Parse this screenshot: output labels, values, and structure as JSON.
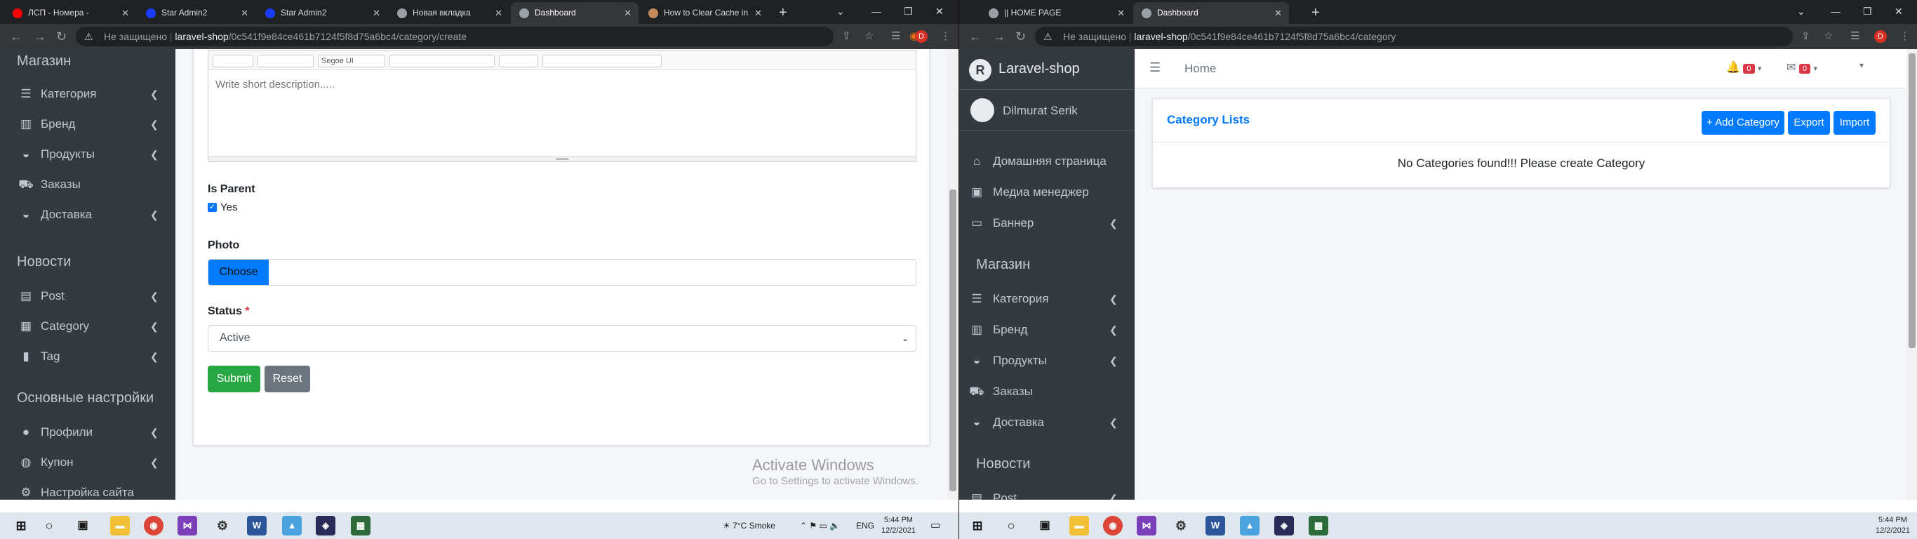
{
  "left": {
    "tabs": [
      {
        "title": "ЛСП - Номера -",
        "active": false,
        "fav": "#ff0000"
      },
      {
        "title": "Star Admin2",
        "active": false,
        "fav": "#1a3cff"
      },
      {
        "title": "Star Admin2",
        "active": false,
        "fav": "#1a3cff"
      },
      {
        "title": "Новая вкладка",
        "active": false,
        "fav": "#9aa0a6"
      },
      {
        "title": "Dashboard",
        "active": true,
        "fav": "#9aa0a6"
      },
      {
        "title": "How to Clear Cache in",
        "active": false,
        "fav": "#c58b5b"
      }
    ],
    "url": {
      "secure_label": "Не защищено",
      "host": "laravel-shop",
      "path": "/0c541f9e84ce461b7124f5f8d75a6bc4/category/create"
    },
    "profile_initial": "D",
    "sidebar": {
      "sections": [
        {
          "title": "Магазин",
          "items": [
            {
              "label": "Категория",
              "icon": "list-icon",
              "glyph": "☰",
              "chev": true
            },
            {
              "label": "Бренд",
              "icon": "building-icon",
              "glyph": "▥",
              "chev": true
            },
            {
              "label": "Продукты",
              "icon": "box-icon",
              "glyph": "◒",
              "chev": true
            },
            {
              "label": "Заказы",
              "icon": "cart-icon",
              "glyph": "⛟",
              "chev": false
            },
            {
              "label": "Доставка",
              "icon": "delivery-icon",
              "glyph": "◒",
              "chev": true
            }
          ]
        },
        {
          "title": "Новости",
          "items": [
            {
              "label": "Post",
              "icon": "post-icon",
              "glyph": "▤",
              "chev": true
            },
            {
              "label": "Category",
              "icon": "category-icon",
              "glyph": "▦",
              "chev": true
            },
            {
              "label": "Tag",
              "icon": "tag-icon",
              "glyph": "▮",
              "chev": true
            }
          ]
        },
        {
          "title": "Основные настройки",
          "items": [
            {
              "label": "Профили",
              "icon": "user-icon",
              "glyph": "●",
              "chev": true
            },
            {
              "label": "Купон",
              "icon": "coupon-icon",
              "glyph": "◍",
              "chev": true
            },
            {
              "label": "Настройка сайта",
              "icon": "gears-icon",
              "glyph": "⚙",
              "chev": false
            }
          ]
        }
      ]
    },
    "form": {
      "editor_placeholder": "Write short description.....",
      "editor_toolbar_font": "Segoe UI",
      "is_parent_label": "Is Parent",
      "is_parent_option": "Yes",
      "photo_label": "Photo",
      "choose_label": "Choose",
      "status_label": "Status",
      "status_required": "*",
      "status_value": "Active",
      "submit_label": "Submit",
      "reset_label": "Reset"
    },
    "watermark": {
      "title": "Activate Windows",
      "sub": "Go to Settings to activate Windows."
    },
    "taskbar": {
      "weather": "7°C  Smoke",
      "lang": "ENG",
      "time": "5:44 PM",
      "date": "12/2/2021"
    }
  },
  "right": {
    "tabs": [
      {
        "title": "|| HOME PAGE",
        "active": false,
        "fav": "#9aa0a6"
      },
      {
        "title": "Dashboard",
        "active": true,
        "fav": "#9aa0a6"
      }
    ],
    "url": {
      "secure_label": "Не защищено",
      "host": "laravel-shop",
      "path": "/0c541f9e84ce461b7124f5f8d75a6bc4/category"
    },
    "profile_initial": "D",
    "brand": "Laravel-shop",
    "user_name": "Dilmurat Serik",
    "sidebar": {
      "top_items": [
        {
          "label": "Домашняя страница",
          "icon": "home-icon",
          "glyph": "⌂",
          "chev": false
        },
        {
          "label": "Медиа менеджер",
          "icon": "media-icon",
          "glyph": "▣",
          "chev": false
        },
        {
          "label": "Баннер",
          "icon": "monitor-icon",
          "glyph": "▭",
          "chev": true
        }
      ],
      "sections": [
        {
          "title": "Магазин",
          "items": [
            {
              "label": "Категория",
              "icon": "list-icon",
              "glyph": "☰",
              "chev": true
            },
            {
              "label": "Бренд",
              "icon": "building-icon",
              "glyph": "▥",
              "chev": true
            },
            {
              "label": "Продукты",
              "icon": "box-icon",
              "glyph": "◒",
              "chev": true
            },
            {
              "label": "Заказы",
              "icon": "cart-icon",
              "glyph": "⛟",
              "chev": false
            },
            {
              "label": "Доставка",
              "icon": "delivery-icon",
              "glyph": "◒",
              "chev": true
            }
          ]
        },
        {
          "title": "Новости",
          "items": [
            {
              "label": "Post",
              "icon": "post-icon",
              "glyph": "▤",
              "chev": true
            }
          ]
        }
      ]
    },
    "navbar": {
      "home": "Home",
      "notif_count": "0",
      "mail_count": "0"
    },
    "card": {
      "title": "Category Lists",
      "add_label": "+ Add Category",
      "export_label": "Export",
      "import_label": "Import",
      "empty_message": "No Categories found!!! Please create Category"
    },
    "taskbar": {
      "time": "5:44 PM",
      "date": "12/2/2021"
    }
  },
  "colors": {
    "primary": "#007bff",
    "success": "#28a745",
    "secondary": "#6c757d",
    "sidebar": "#343a40",
    "danger": "#dc3545"
  }
}
